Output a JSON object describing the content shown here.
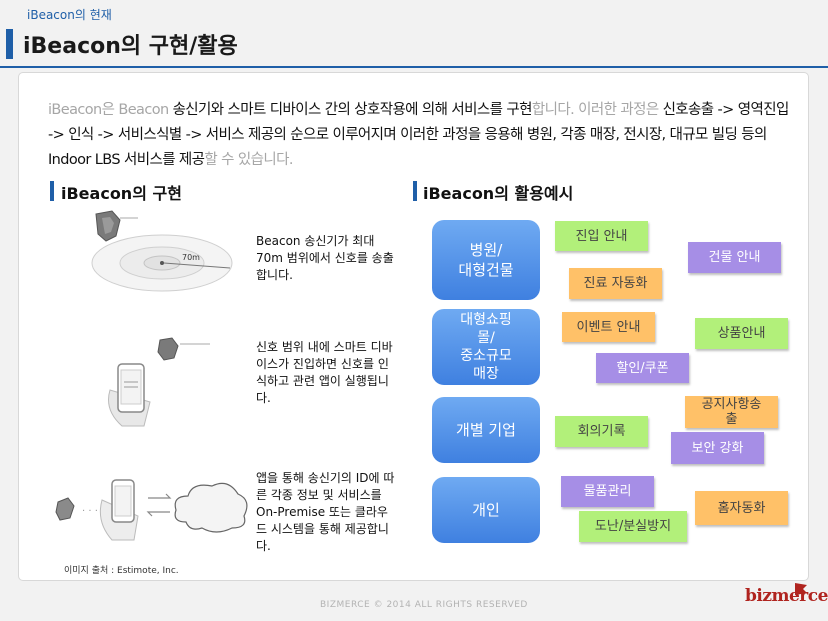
{
  "header": {
    "supertitle": "iBeacon의 현재",
    "title": "iBeacon의 구현/활용"
  },
  "intro": {
    "s1": "iBeacon은 Beacon",
    "s2": " 송신기와 스마트 디바이스 간의 상호작용에 의해 서비스를 구현",
    "s3": "합니다. 이러한 과정은",
    "s4": " 신호송출 -> 영역진입 -> 인식 -> 서비스식별 -> 서비스 제공의 순으로 이루어지며 이러한 과정을 응용해  병원, 각종 매장, 전시장, 대규모 빌딩 등의 Indoor LBS 서비스를 제공",
    "s5": "할 수 있습니다."
  },
  "implementation": {
    "heading": "iBeacon의 구현",
    "step1": "Beacon 송신기가 최대 70m 범위에서 신호를 송출합니다.",
    "step2": "신호 범위 내에 스마트 디바이스가 진입하면 신호를 인식하고 관련 앱이 실행됩니다.",
    "step3": "앱을 통해 송신기의 ID에 따른 각종 정보 및 서비스를 On-Premise 또는 클라우드 시스템을 통해 제공합니다.",
    "img1_label": "70m",
    "credit": "이미지 출처 : Estimote, Inc."
  },
  "usage": {
    "heading": "iBeacon의 활용예시",
    "categories": [
      {
        "label": "병원/\n대형건물"
      },
      {
        "label": "대형쇼핑\n몰/\n중소규모\n매장"
      },
      {
        "label": "개별 기업"
      },
      {
        "label": "개인"
      }
    ],
    "tags": {
      "entry": "진입 안내",
      "building": "건물 안내",
      "treatment": "진료 자동화",
      "event": "이벤트 안내",
      "product": "상품안내",
      "discount": "할인/쿠폰",
      "notice": "공지사항송\n출",
      "meeting": "회의기록",
      "security": "보안 강화",
      "items": "물품관리",
      "home": "홈자동화",
      "theft": "도난/분실방지"
    }
  },
  "footer": {
    "copyright": "BIZMERCE © 2014 ALL RIGHTS RESERVED",
    "logo": "bizmerce"
  },
  "colors": {
    "accent": "#1f5fa8",
    "category_blue": "#4a8cea",
    "tag_green": "#b2f07a",
    "tag_orange": "#ffc168",
    "tag_purple": "#a68ee6",
    "logo_red": "#b0241f"
  }
}
